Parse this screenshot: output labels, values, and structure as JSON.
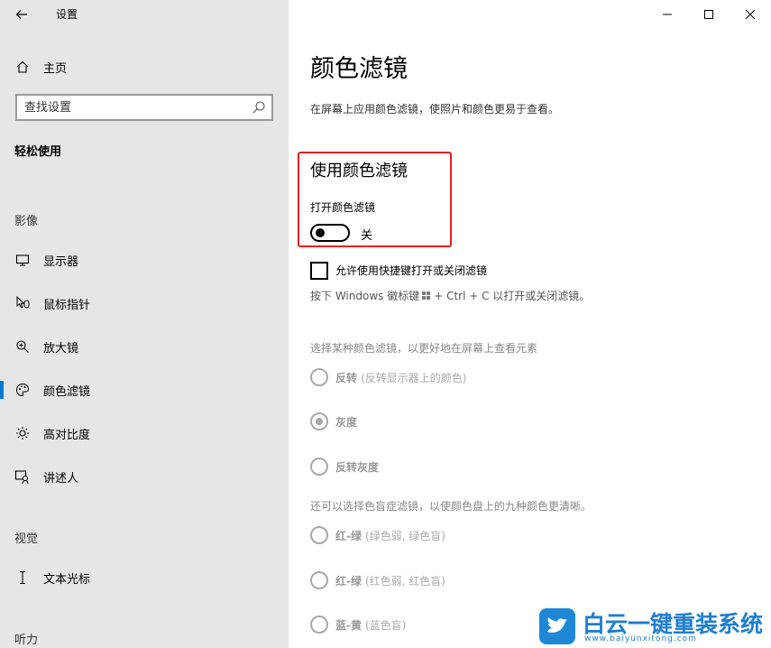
{
  "window": {
    "title": "设置"
  },
  "sidebar": {
    "home_label": "主页",
    "search_placeholder": "查找设置",
    "section_title": "轻松使用",
    "groups": [
      {
        "label": "影像"
      },
      {
        "label": "视觉"
      },
      {
        "label": "听力"
      }
    ],
    "items": [
      {
        "label": "显示器",
        "icon": "monitor-icon"
      },
      {
        "label": "鼠标指针",
        "icon": "mouse-pointer-icon"
      },
      {
        "label": "放大镜",
        "icon": "magnifier-icon"
      },
      {
        "label": "颜色滤镜",
        "icon": "palette-icon",
        "selected": true
      },
      {
        "label": "高对比度",
        "icon": "brightness-icon"
      },
      {
        "label": "讲述人",
        "icon": "narrator-icon"
      },
      {
        "label": "文本光标",
        "icon": "text-cursor-icon"
      }
    ]
  },
  "content": {
    "title": "颜色滤镜",
    "description": "在屏幕上应用颜色滤镜，使照片和颜色更易于查看。",
    "section_heading": "使用颜色滤镜",
    "toggle_label": "打开颜色滤镜",
    "toggle_state": "关",
    "toggle_on": false,
    "shortcut_checkbox_label": "允许使用快捷键打开或关闭滤镜",
    "shortcut_checked": false,
    "shortcut_hint_prefix": "按下 Windows 徽标键",
    "shortcut_hint_suffix": "+ Ctrl + C 以打开或关闭滤镜。",
    "choose_filter_desc": "选择某种颜色滤镜，以更好地在屏幕上查看元素",
    "filters": [
      {
        "label": "反转",
        "sub": "(反转显示器上的颜色)",
        "checked": false
      },
      {
        "label": "灰度",
        "sub": "",
        "checked": true
      },
      {
        "label": "反转灰度",
        "sub": "",
        "checked": false
      }
    ],
    "colorblind_desc": "还可以选择色盲症滤镜，以使颜色盘上的九种颜色更清晰。",
    "colorblind_filters": [
      {
        "label": "红-绿",
        "sub": "(绿色弱, 绿色盲)",
        "checked": false
      },
      {
        "label": "红-绿",
        "sub": "(红色弱, 红色盲)",
        "checked": false
      },
      {
        "label": "蓝-黄",
        "sub": "(蓝色盲)",
        "checked": false
      }
    ]
  },
  "watermark": {
    "name": "白云一键重装系统",
    "url": "www.baiyunxitong.com"
  },
  "colors": {
    "accent": "#0078d7",
    "highlight": "#e02020",
    "sidebar_bg": "#e6e6e6",
    "watermark_blue": "#1e7ed0"
  }
}
